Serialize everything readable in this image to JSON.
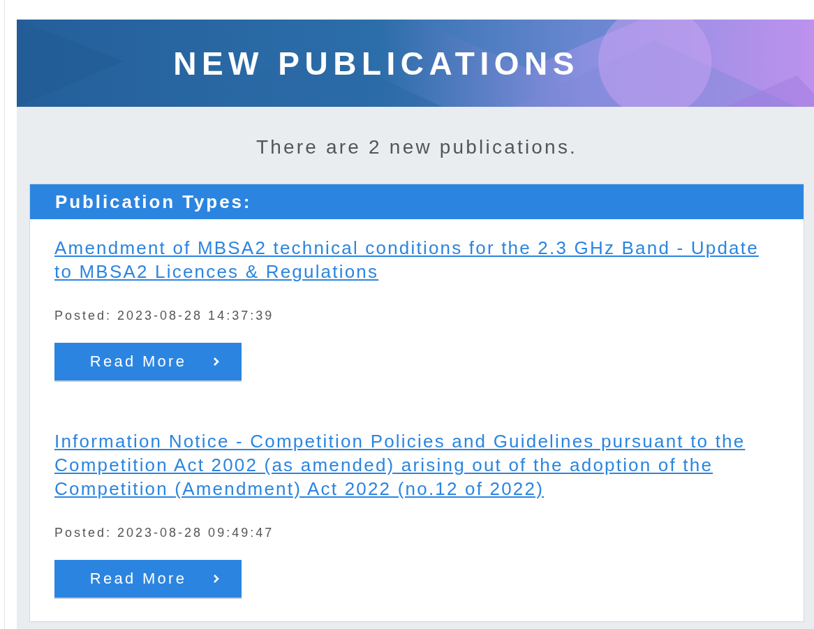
{
  "header": {
    "title": "NEW PUBLICATIONS"
  },
  "intro": "There are 2 new publications.",
  "section": {
    "title": "Publication Types:"
  },
  "publications": [
    {
      "title": "Amendment of MBSA2 technical conditions for the 2.3 GHz Band - Update to MBSA2 Licences & Regulations",
      "posted": "Posted: 2023-08-28 14:37:39",
      "button": "Read More"
    },
    {
      "title": "Information Notice - Competition Policies and Guidelines pursuant to the Competition Act 2002 (as amended) arising out of the adoption of the Competition (Amendment) Act 2022 (no.12 of 2022)",
      "posted": "Posted: 2023-08-28 09:49:47",
      "button": "Read More"
    }
  ]
}
